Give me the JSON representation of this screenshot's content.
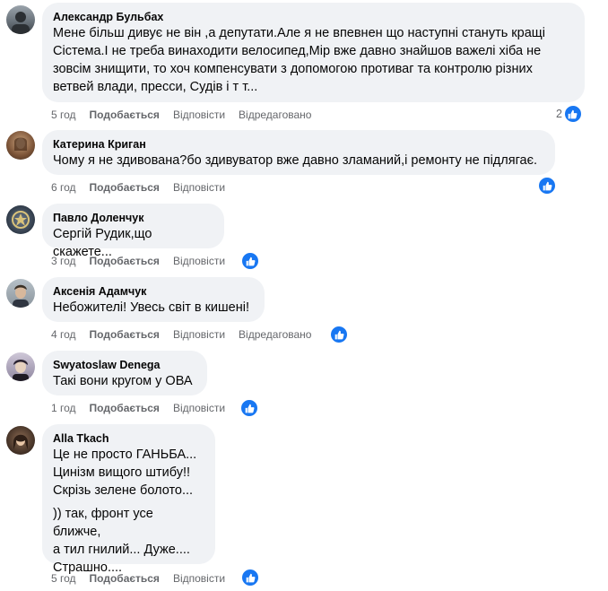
{
  "comments": [
    {
      "author": "Александр Бульбах",
      "text": "Мене більш дивує не він ,а депутати.Але я не впевнен що наступні стануть кращі\nСістема.І не треба винаходити велосипед,Мір вже давно знайшов важелі хіба не\nзовсім знищити, то хоч компенсувати з допомогою противаг та контролю різних\nветвей влади, пресси, Судів і т т...",
      "time": "5 год",
      "like": "Подобається",
      "reply": "Відповісти",
      "edited": "Відредаговано",
      "reactions": "2"
    },
    {
      "author": "Катерина Криган",
      "text": "Чому я не здивована?бо здивуватор вже давно зламаний,і ремонту не підлягає.",
      "time": "6 год",
      "like": "Подобається",
      "reply": "Відповісти"
    },
    {
      "author": "Павло Доленчук",
      "text": "Сергій Рудик,що скажете...",
      "time": "3 год",
      "like": "Подобається",
      "reply": "Відповісти"
    },
    {
      "author": "Аксенія Адамчук",
      "text": "Небожителі! Увесь світ в кишені!",
      "time": "4 год",
      "like": "Подобається",
      "reply": "Відповісти",
      "edited": "Відредаговано"
    },
    {
      "author": "Swyatoslaw Denega",
      "text": "Такі вони кругом у ОВА",
      "time": "1 год",
      "like": "Подобається",
      "reply": "Відповісти"
    },
    {
      "author": "Alla Tkach",
      "text": "Це не просто ГАНЬБА...\nЦинізм вищого штибу!!\nСкрізь зелене болото...",
      "text2": ")) так, фронт усе ближче,\nа тил гнилий... Дуже....\nСтрашно....",
      "time": "5 год",
      "like": "Подобається",
      "reply": "Відповісти"
    }
  ],
  "icons": {
    "reaction": "like-icon"
  },
  "colors": {
    "bubble": "#f0f2f5",
    "meta": "#65676b",
    "like": "#1877f2"
  }
}
